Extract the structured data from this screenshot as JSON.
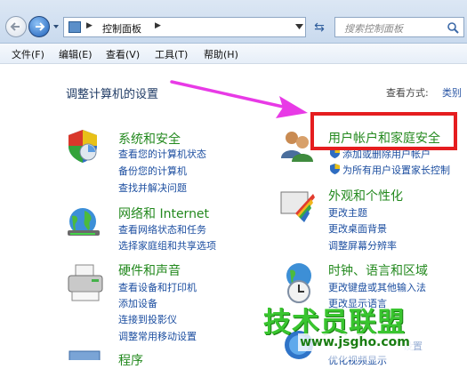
{
  "toolbar": {
    "breadcrumb": "控制面板",
    "search_placeholder": "搜索控制面板"
  },
  "menu": {
    "file": "文件(F)",
    "edit": "编辑(E)",
    "view": "查看(V)",
    "tools": "工具(T)",
    "help": "帮助(H)"
  },
  "main": {
    "heading": "调整计算机的设置",
    "view_by_label": "查看方式:",
    "view_by_value": "类别"
  },
  "categories": {
    "system": {
      "title": "系统和安全",
      "links": [
        "查看您的计算机状态",
        "备份您的计算机",
        "查找并解决问题"
      ]
    },
    "network": {
      "title": "网络和 Internet",
      "links": [
        "查看网络状态和任务",
        "选择家庭组和共享选项"
      ]
    },
    "hardware": {
      "title": "硬件和声音",
      "links": [
        "查看设备和打印机",
        "添加设备",
        "连接到投影仪",
        "调整常用移动设置"
      ]
    },
    "programs": {
      "title": "程序"
    },
    "users": {
      "title": "用户帐户和家庭安全",
      "links": [
        "添加或删除用户帐户",
        "为所有用户设置家长控制"
      ]
    },
    "appearance": {
      "title": "外观和个性化",
      "links": [
        "更改主题",
        "更改桌面背景",
        "调整屏幕分辨率"
      ]
    },
    "clock": {
      "title": "时钟、语言和区域",
      "links": [
        "更改键盘或其他输入法",
        "更改显示语言"
      ]
    },
    "ease": {
      "links": [
        "设置",
        "优化视频显示"
      ]
    }
  },
  "watermark": {
    "brand": "技术员联盟",
    "url": "www.jsgho.com"
  },
  "colors": {
    "category_title": "#23891e",
    "link": "#1c4ea0",
    "highlight_box": "#e51d1f",
    "arrow": "#e83ae6"
  }
}
